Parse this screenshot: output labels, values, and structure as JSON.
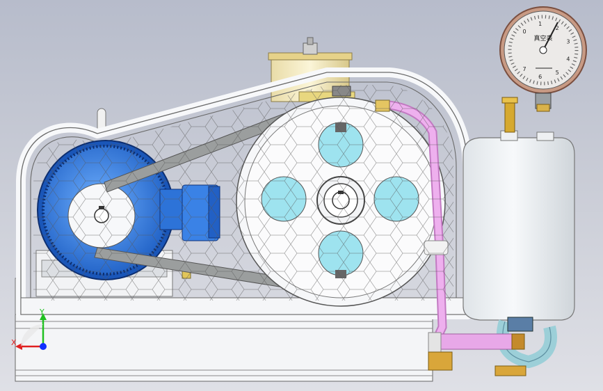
{
  "window": {
    "title": "",
    "background_top": "#b7bccb",
    "background_bottom": "#dfe0e6"
  },
  "model": {
    "type": "roots-blower-assembly",
    "motor_color": "#2f7de0",
    "frame_color": "#f2f4f6",
    "hose_color": "#e39be3",
    "rotor_window_color": "#9ee3ef",
    "brass_color": "#c8a23c"
  },
  "gauge": {
    "label": "真空表",
    "scale": [
      "0",
      "1",
      "2",
      "3",
      "4",
      "5",
      "6",
      "7"
    ]
  },
  "triad": {
    "x_label": "X",
    "y_label": "Y",
    "x_color": "#e02020",
    "y_color": "#20c020",
    "z_color": "#1030ff"
  }
}
